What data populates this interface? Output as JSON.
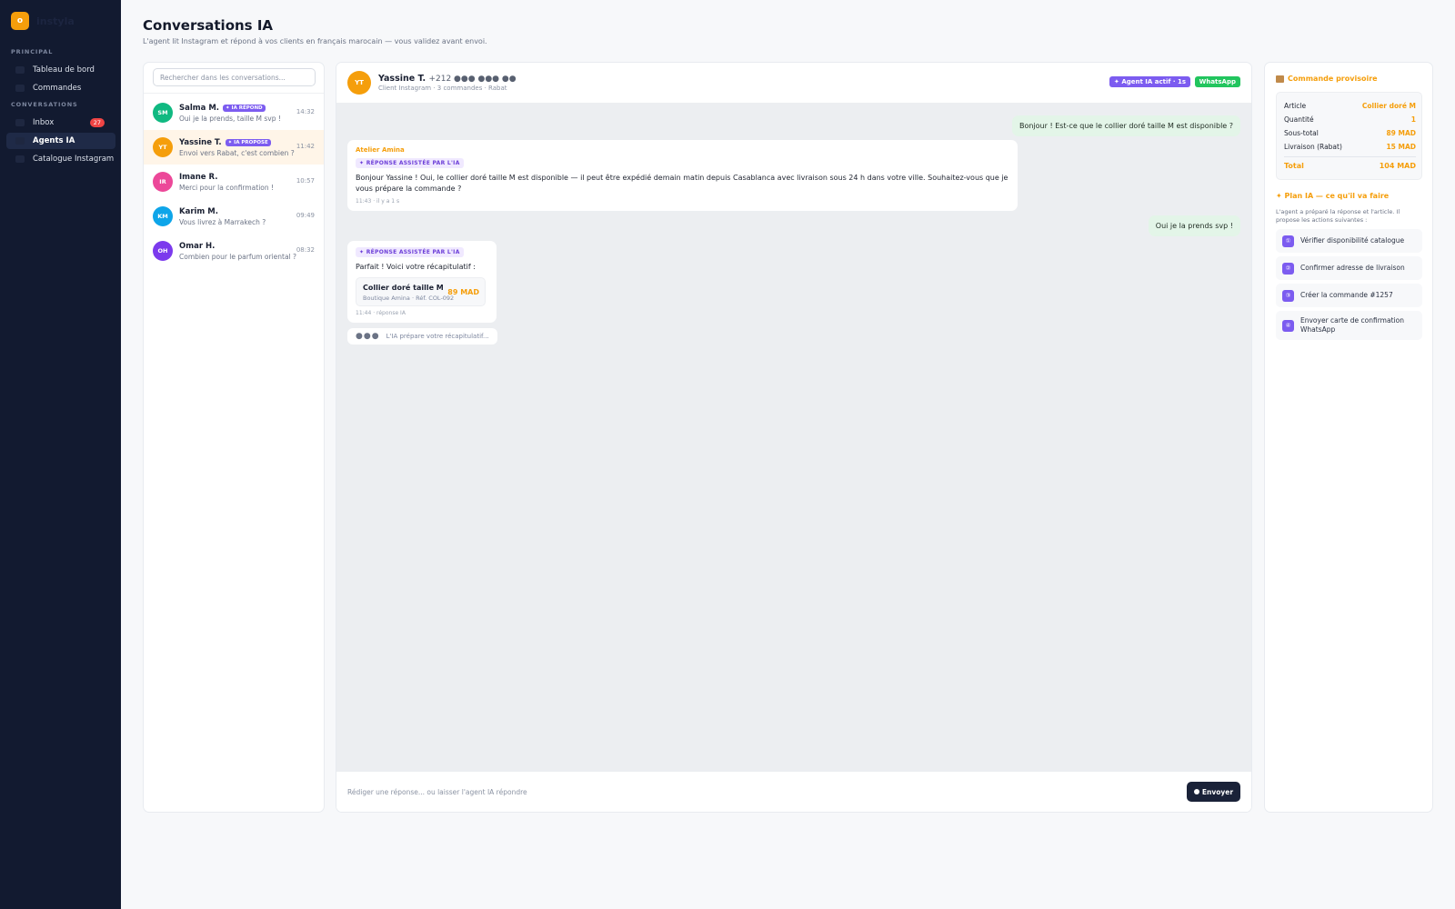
{
  "app": {
    "logo_initial": "o",
    "name": "instyla"
  },
  "sidebar": {
    "sections": [
      {
        "label": "PRINCIPAL"
      },
      {
        "label": "CONVERSATIONS"
      }
    ],
    "items": [
      {
        "label": "Tableau de bord"
      },
      {
        "label": "Commandes"
      },
      {
        "label": "Inbox",
        "badge": "27"
      },
      {
        "label": "Agents IA",
        "active": true
      },
      {
        "label": "Catalogue Instagram"
      }
    ]
  },
  "header": {
    "title": "Conversations IA",
    "subtitle": "L'agent lit Instagram et répond à vos clients en français marocain — vous validez avant envoi."
  },
  "conversations": {
    "search_placeholder": "Rechercher dans les conversations...",
    "items": [
      {
        "initials": "SM",
        "name": "Salma M.",
        "tag": "✦ IA RÉPOND",
        "preview": "Oui je la prends, taille M svp !",
        "time": "14:32",
        "color": "#10b981"
      },
      {
        "initials": "YT",
        "name": "Yassine T.",
        "tag": "✦ IA PROPOSE",
        "preview": "Envoi vers Rabat, c'est combien ?",
        "time": "11:42",
        "color": "#f59e0b",
        "active": true
      },
      {
        "initials": "IR",
        "name": "Imane R.",
        "tag": "",
        "preview": "Merci pour la confirmation !",
        "time": "10:57",
        "color": "#ec4899"
      },
      {
        "initials": "KM",
        "name": "Karim M.",
        "tag": "",
        "preview": "Vous livrez à Marrakech ?",
        "time": "09:49",
        "color": "#0ea5e9"
      },
      {
        "initials": "OH",
        "name": "Omar H.",
        "tag": "",
        "preview": "Combien pour le parfum oriental ?",
        "time": "08:32",
        "color": "#7c3aed"
      }
    ]
  },
  "chat": {
    "contact": {
      "initials": "YT",
      "name": "Yassine T.",
      "phone": "+212 ●●● ●●● ●●",
      "meta": "Client Instagram · 3 commandes · Rabat"
    },
    "badge_ai": "✦ Agent IA actif · 1s",
    "badge_channel": "WhatsApp",
    "messages": {
      "m1": "Bonjour ! Est-ce que le collier doré taille M est disponible ?",
      "m2_sender": "Atelier Amina",
      "m2_tag": "✦ RÉPONSE ASSISTÉE PAR L'IA",
      "m2_text": "Bonjour Yassine ! Oui, le collier doré taille M est disponible — il peut être expédié demain matin depuis Casablanca avec livraison sous 24 h dans votre ville. Souhaitez-vous que je vous prépare la commande ?",
      "m2_time": "11:43 · il y a 1 s",
      "m3": "Oui je la prends svp !",
      "m4_tag": "✦ RÉPONSE ASSISTÉE PAR L'IA",
      "m4_text": "Parfait ! Voici votre récapitulatif :",
      "m4_product_name": "Collier doré taille M",
      "m4_product_sub": "Boutique Amina · Réf. COL-092",
      "m4_product_price": "89 MAD",
      "m4_time": "11:44 · réponse IA"
    },
    "typing_text": "L'IA prépare votre récapitulatif...",
    "composer_placeholder": "Rédiger une réponse... ou laisser l'agent IA répondre",
    "send_label": "Envoyer"
  },
  "order": {
    "title": "Commande provisoire",
    "rows": [
      {
        "label": "Article",
        "value": "Collier doré M"
      },
      {
        "label": "Quantité",
        "value": "1"
      },
      {
        "label": "Sous-total",
        "value": "89 MAD"
      },
      {
        "label": "Livraison (Rabat)",
        "value": "15 MAD"
      }
    ],
    "total_label": "Total",
    "total_value": "104 MAD"
  },
  "plan": {
    "title": "✦ Plan IA — ce qu'il va faire",
    "description": "L'agent a préparé la réponse et l'article. Il propose les actions suivantes :",
    "steps": [
      {
        "num": "①",
        "label": "Vérifier disponibilité catalogue"
      },
      {
        "num": "②",
        "label": "Confirmer adresse de livraison"
      },
      {
        "num": "③",
        "label": "Créer la commande #1257"
      },
      {
        "num": "④",
        "label": "Envoyer carte de confirmation WhatsApp"
      }
    ]
  },
  "colors": {
    "accent": "#f59e0b",
    "ai_purple": "#7c5cf0",
    "whatsapp_green": "#22c55e",
    "sidebar_bg": "#121a30"
  }
}
